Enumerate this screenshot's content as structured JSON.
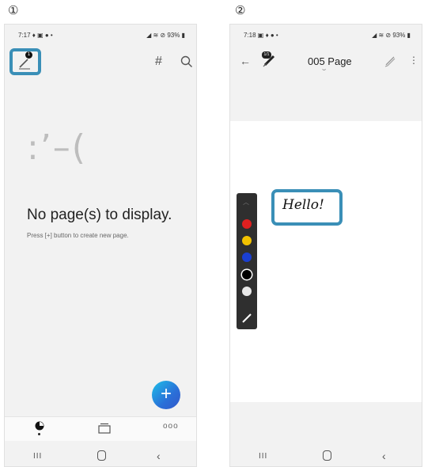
{
  "steps": [
    "①",
    "②"
  ],
  "screen1": {
    "status_time": "7:17 ♦ ▣ ● •",
    "status_right": "◢ ≋ ⊘ 93% ▮",
    "badge_count": "1",
    "hash_label": "#",
    "empty_face": ":’–(",
    "empty_title": "No page(s) to display.",
    "empty_hint": "Press [+] button to create new page.",
    "fab_label": "+",
    "more_label": "ooo",
    "nav_recent": "III",
    "nav_back": "‹"
  },
  "screen2": {
    "status_time": "7:18 ▣ ♦ ● •",
    "status_right": "◢ ≋ ⊘ 93% ▮",
    "back_label": "←",
    "pen_badge": "1/1",
    "page_title": "005 Page",
    "title_chevron": "⌣",
    "kebab_label": "⋮",
    "palette_chevron": "︿",
    "palette_colors": [
      "#e02020",
      "#f2c200",
      "#1a3fd1",
      "#000000",
      "#e8e8e8"
    ],
    "selected_color": "#000000",
    "handwriting": "Hello!",
    "nav_recent": "III",
    "nav_back": "‹"
  },
  "colors": {
    "highlight": "#3a8fb7"
  }
}
